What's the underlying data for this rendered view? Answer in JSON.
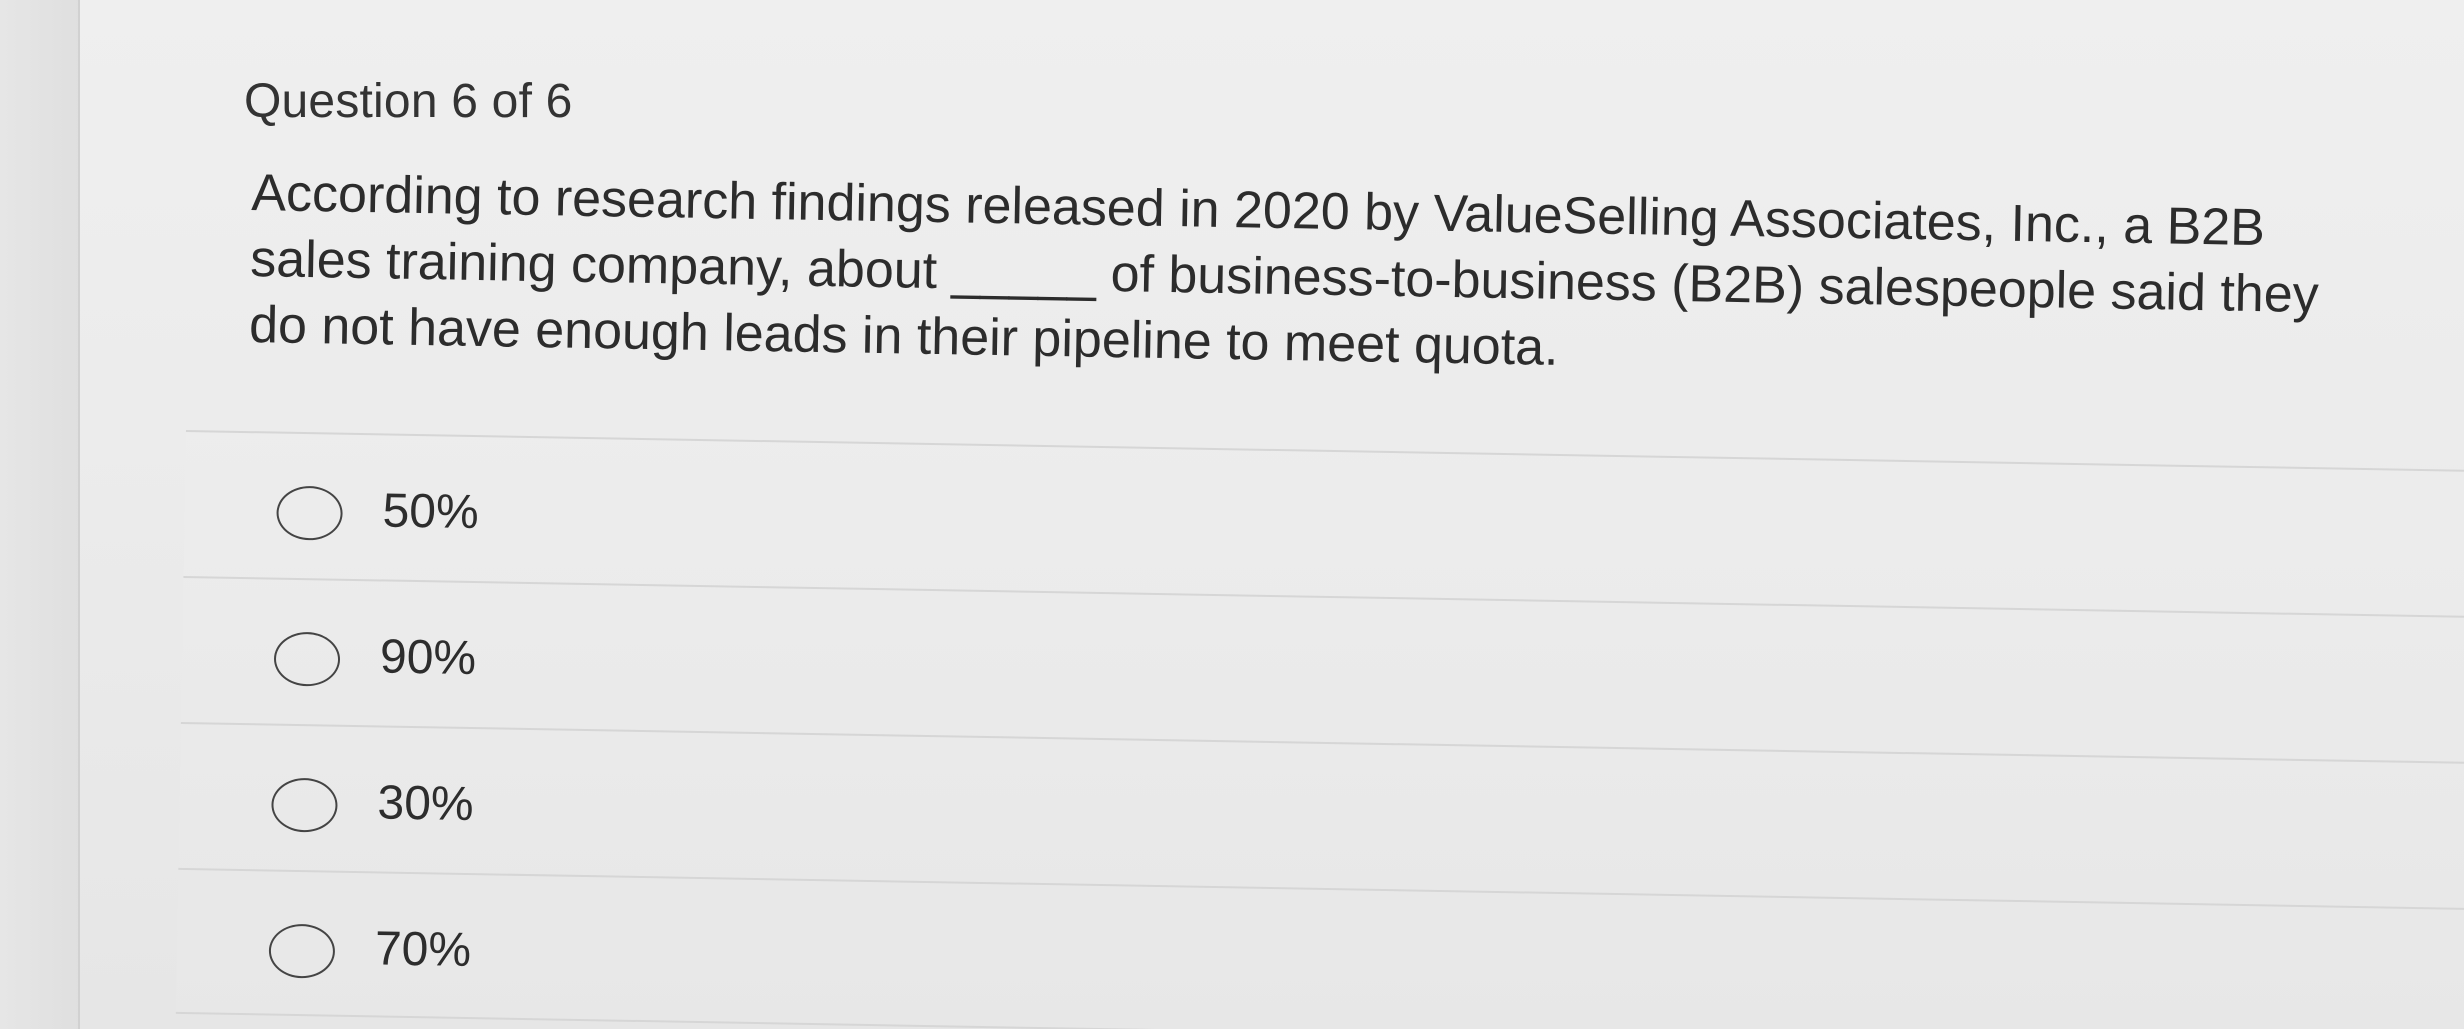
{
  "question": {
    "number_text": "Question 6 of 6",
    "prompt": "According to research findings released in 2020 by ValueSelling Associates, Inc., a B2B sales training company, about _____ of business-to-business (B2B) salespeople said they do not have enough leads in their pipeline to meet quota."
  },
  "answers": [
    {
      "label": "50%"
    },
    {
      "label": "90%"
    },
    {
      "label": "30%"
    },
    {
      "label": "70%"
    }
  ]
}
